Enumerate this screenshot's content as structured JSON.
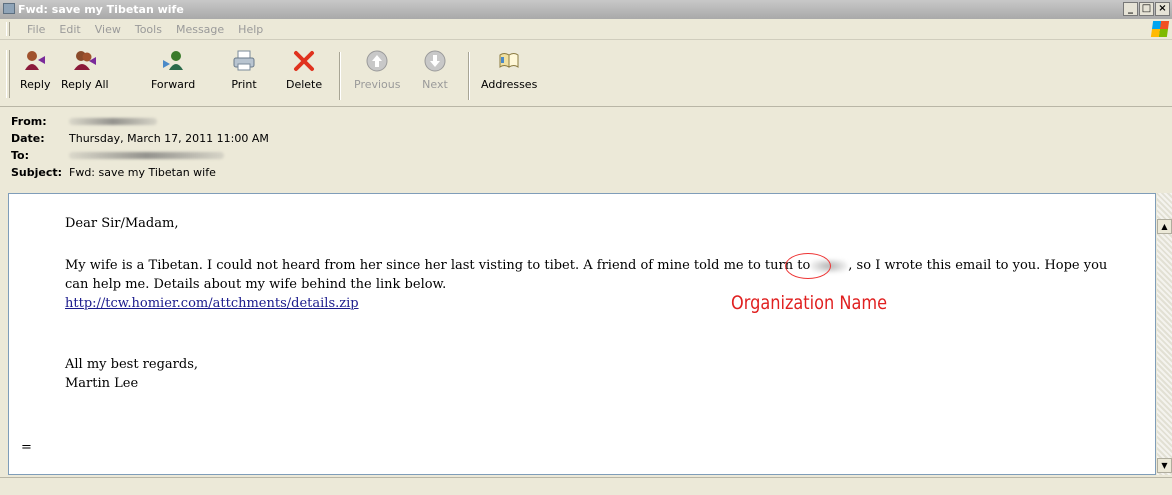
{
  "window": {
    "title": "Fwd: save my Tibetan wife"
  },
  "menu": [
    "File",
    "Edit",
    "View",
    "Tools",
    "Message",
    "Help"
  ],
  "toolbar": {
    "reply": "Reply",
    "reply_all": "Reply All",
    "forward": "Forward",
    "print": "Print",
    "delete": "Delete",
    "previous": "Previous",
    "next": "Next",
    "addresses": "Addresses"
  },
  "header": {
    "from_label": "From:",
    "date_label": "Date:",
    "date_value": "Thursday, March 17, 2011 11:00 AM",
    "to_label": "To:",
    "subject_label": "Subject:",
    "subject_value": "Fwd: save my Tibetan wife"
  },
  "message": {
    "greeting": "Dear Sir/Madam,",
    "para1_a": "My wife is a Tibetan. I could not heard from her since her last visting to tibet. A friend of mine told me to turn to",
    "para1_b": ", so I wrote this email to you. Hope you",
    "para1_c": "can help me. Details about my wife behind the link below.",
    "link": "http://tcw.homier.com/attchments/details.zip",
    "closing": "All my best regards,",
    "signature": "Martin Lee",
    "trailer": "="
  },
  "annotation": {
    "text": "Organization Name",
    "color": "#e02020"
  }
}
